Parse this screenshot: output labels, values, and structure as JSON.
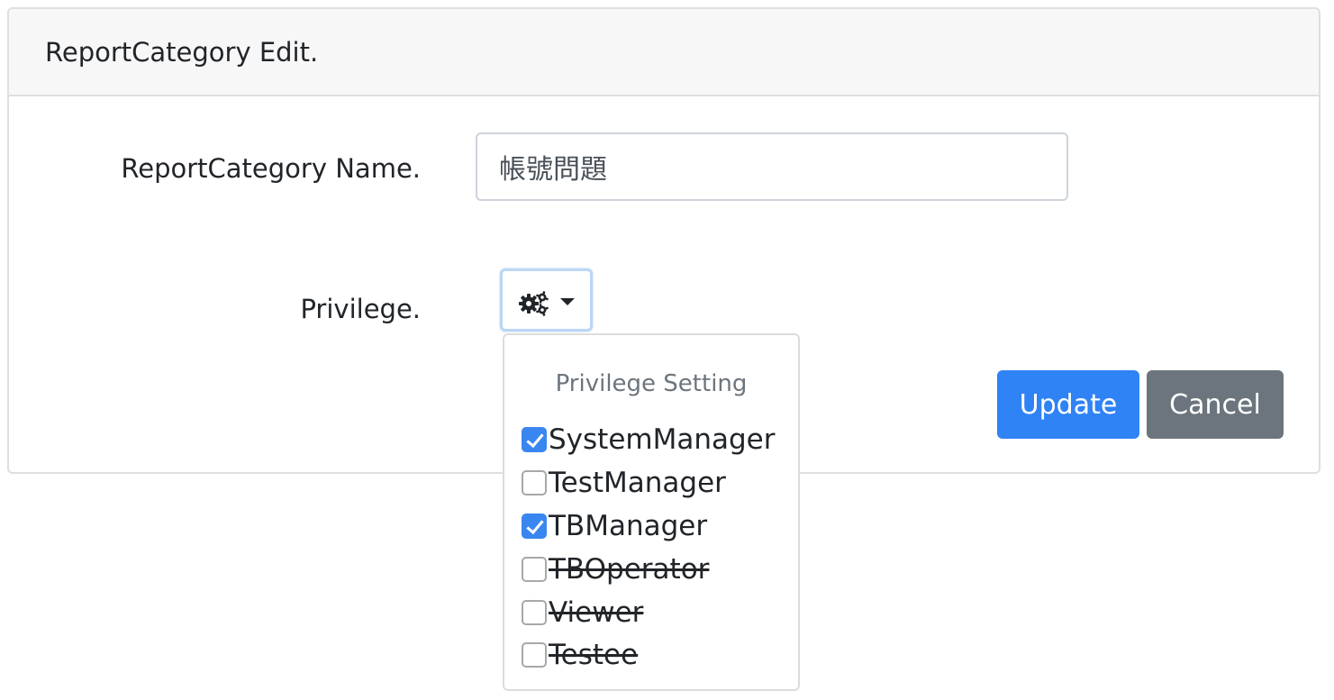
{
  "card": {
    "title": "ReportCategory Edit."
  },
  "form": {
    "name_label": "ReportCategory Name.",
    "name_value": "帳號問題",
    "privilege_label": "Privilege."
  },
  "privilege_dropdown": {
    "toggle_icon": "gears-icon",
    "header": "Privilege Setting",
    "options": [
      {
        "label": "SystemManager",
        "checked": true,
        "strikethrough": false
      },
      {
        "label": "TestManager",
        "checked": false,
        "strikethrough": false
      },
      {
        "label": "TBManager",
        "checked": true,
        "strikethrough": false
      },
      {
        "label": "TBOperator",
        "checked": false,
        "strikethrough": true
      },
      {
        "label": "Viewer",
        "checked": false,
        "strikethrough": true
      },
      {
        "label": "Testee",
        "checked": false,
        "strikethrough": true
      }
    ]
  },
  "buttons": {
    "update_label": "Update",
    "cancel_label": "Cancel"
  },
  "colors": {
    "primary": "#2f83f5",
    "secondary": "#6c757d",
    "checkbox_checked": "#3a86f0"
  }
}
